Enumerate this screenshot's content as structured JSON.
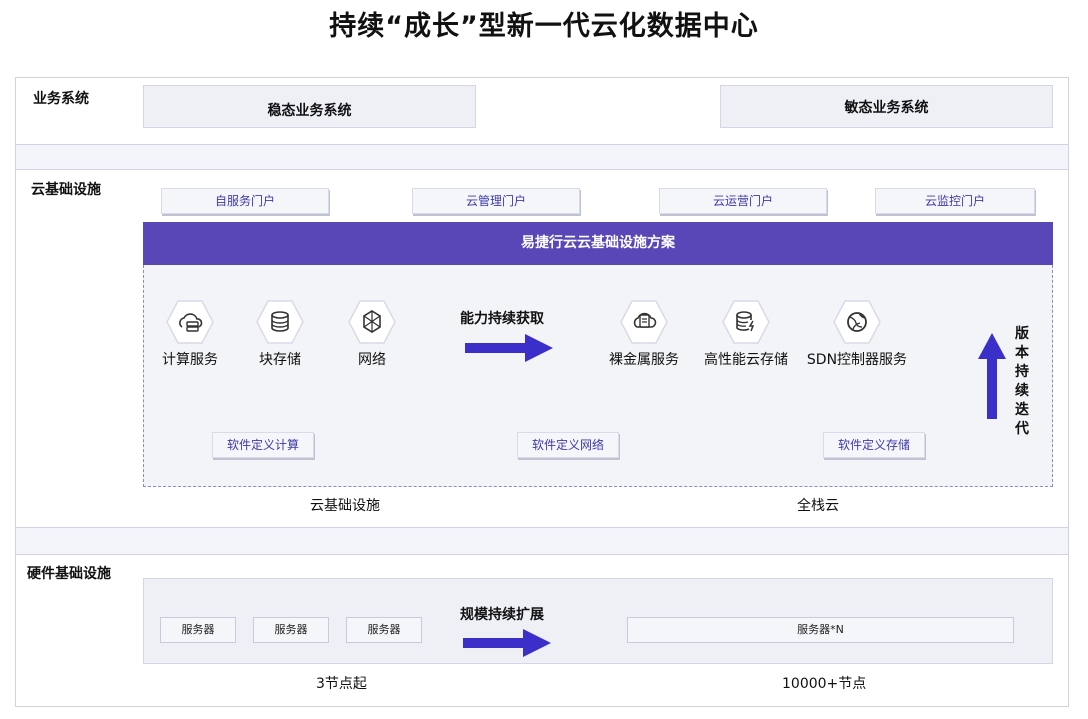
{
  "title": "持续“成长”型新一代云化数据中心",
  "business": {
    "label": "业务系统",
    "stable": "稳态业务系统",
    "agile": "敏态业务系统"
  },
  "cloud": {
    "label": "云基础设施",
    "portals": [
      "自服务门户",
      "云管理门户",
      "云运营门户",
      "云监控门户"
    ],
    "bar_title": "易捷行云云基础设施方案",
    "services_left": [
      {
        "label": "计算服务",
        "icon": "cloud-server-icon"
      },
      {
        "label": "块存储",
        "icon": "database-icon"
      },
      {
        "label": "网络",
        "icon": "network-cube-icon"
      }
    ],
    "services_right": [
      {
        "label": "裸金属服务",
        "icon": "bare-metal-icon"
      },
      {
        "label": "高性能云存储",
        "icon": "storage-bolt-icon"
      },
      {
        "label": "SDN控制器服务",
        "icon": "globe-icon"
      }
    ],
    "capability_label": "能力持续获取",
    "sd_boxes": [
      "软件定义计算",
      "软件定义网络",
      "软件定义存储"
    ],
    "footer_left": "云基础设施",
    "footer_right": "全栈云",
    "version_text": "版本持续迭代"
  },
  "hardware": {
    "label": "硬件基础设施",
    "servers": [
      "服务器",
      "服务器",
      "服务器"
    ],
    "server_n": "服务器*N",
    "scale_label": "规模持续扩展",
    "footer_left": "3节点起",
    "footer_right": "10000+节点"
  },
  "colors": {
    "accent": "#5a47b7",
    "arrow": "#3b2fc9",
    "portal_text": "#3d3aa8"
  }
}
